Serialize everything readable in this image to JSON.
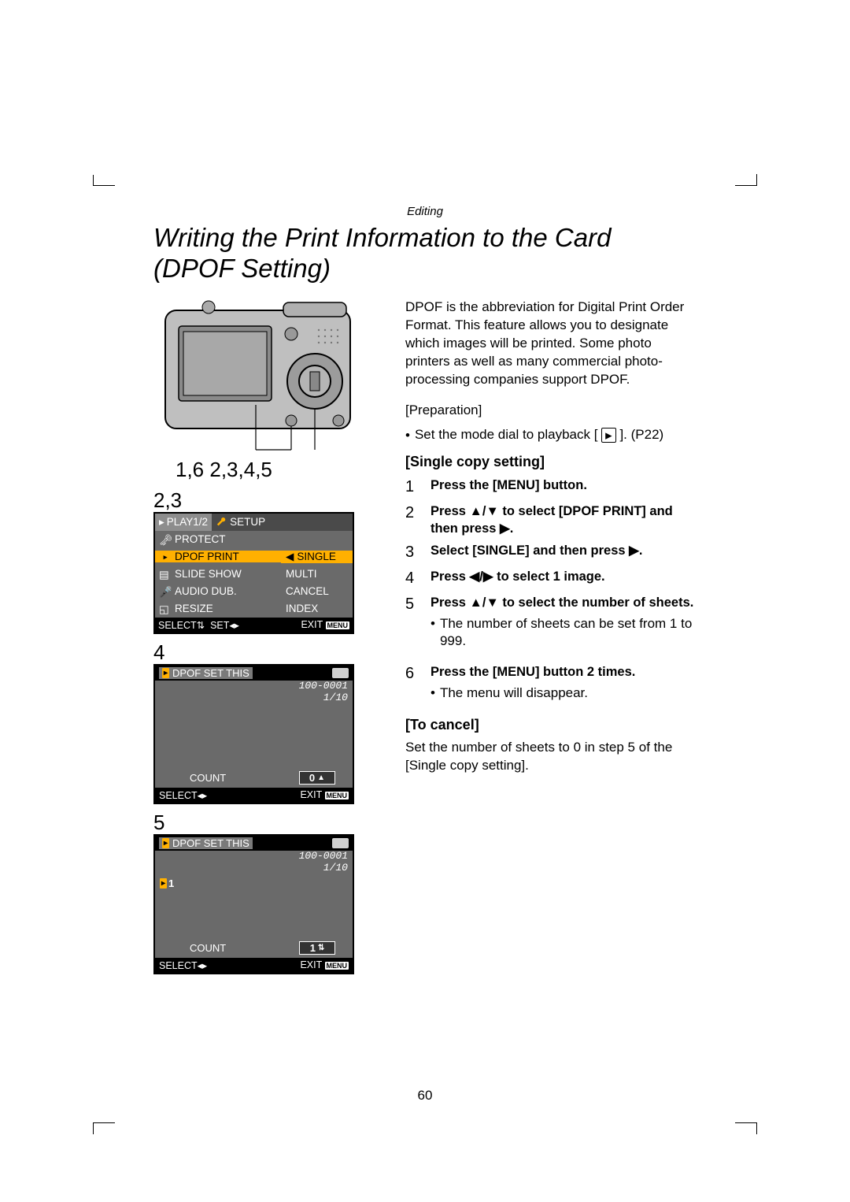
{
  "section": "Editing",
  "title": "Writing the Print Information to the Card (DPOF Setting)",
  "callout_camera": "1,6  2,3,4,5",
  "step_label_23": "2,3",
  "step_label_4": "4",
  "step_label_5": "5",
  "menu_screen": {
    "tab_left": "PLAY1/2",
    "tab_right": "SETUP",
    "items": [
      {
        "icon": "key-icon",
        "label": "PROTECT",
        "right": ""
      },
      {
        "icon": "dpof-icon",
        "label": "DPOF PRINT",
        "right": "SINGLE",
        "highlight": true
      },
      {
        "icon": "slide-icon",
        "label": "SLIDE SHOW",
        "right": "MULTI"
      },
      {
        "icon": "audio-icon",
        "label": "AUDIO DUB.",
        "right": "CANCEL"
      },
      {
        "icon": "resize-icon",
        "label": "RESIZE",
        "right": "INDEX"
      }
    ],
    "footer_select": "SELECT",
    "footer_set": "SET",
    "footer_exit": "EXIT",
    "footer_menu": "MENU"
  },
  "dpof_screen_4": {
    "header": "DPOF SET THIS",
    "file_no": "100-0001",
    "index": "1/10",
    "count_label": "COUNT",
    "count_value": "0",
    "arrow_mode": "up",
    "footer_select": "SELECT",
    "footer_exit": "EXIT",
    "footer_menu": "MENU"
  },
  "dpof_screen_5": {
    "header": "DPOF SET THIS",
    "file_no": "100-0001",
    "index": "1/10",
    "badge_value": "1",
    "count_label": "COUNT",
    "count_value": "1",
    "arrow_mode": "updown",
    "footer_select": "SELECT",
    "footer_exit": "EXIT",
    "footer_menu": "MENU"
  },
  "intro": "DPOF is the abbreviation for Digital Print Order Format. This feature allows you to designate which images will be printed. Some photo printers as well as many commercial photo-processing companies support DPOF.",
  "prep_label": "[Preparation]",
  "prep_bullet_a": "Set the mode dial to playback [",
  "prep_bullet_b": "]. (P22)",
  "single_head": "[Single copy setting]",
  "steps": {
    "s1": "Press the [MENU] button.",
    "s2a": "Press ▲/▼ to select [DPOF PRINT] and then press ▶.",
    "s3": "Select [SINGLE] and then press ▶.",
    "s4": "Press ◀/▶ to select 1 image.",
    "s5": "Press ▲/▼ to select the number of sheets.",
    "s5_sub": "The number of sheets can be set from 1 to 999.",
    "s6": "Press the [MENU] button 2 times.",
    "s6_sub": "The menu will disappear."
  },
  "cancel_head": "[To cancel]",
  "cancel_text": "Set the number of sheets to 0 in step 5 of the [Single copy setting].",
  "page_number": "60"
}
